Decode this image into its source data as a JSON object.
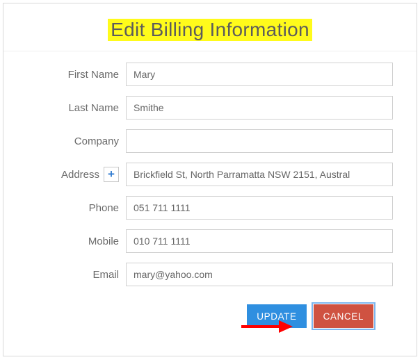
{
  "title": "Edit Billing Information",
  "labels": {
    "first_name": "First Name",
    "last_name": "Last Name",
    "company": "Company",
    "address": "Address",
    "phone": "Phone",
    "mobile": "Mobile",
    "email": "Email"
  },
  "values": {
    "first_name": "Mary",
    "last_name": "Smithe",
    "company": "",
    "address": "Brickfield St, North Parramatta NSW 2151, Austral",
    "phone": "051 711 1111",
    "mobile": "010 711 1111",
    "email": "mary@yahoo.com"
  },
  "buttons": {
    "add_address": "+",
    "update": "UPDATE",
    "cancel": "CANCEL"
  }
}
